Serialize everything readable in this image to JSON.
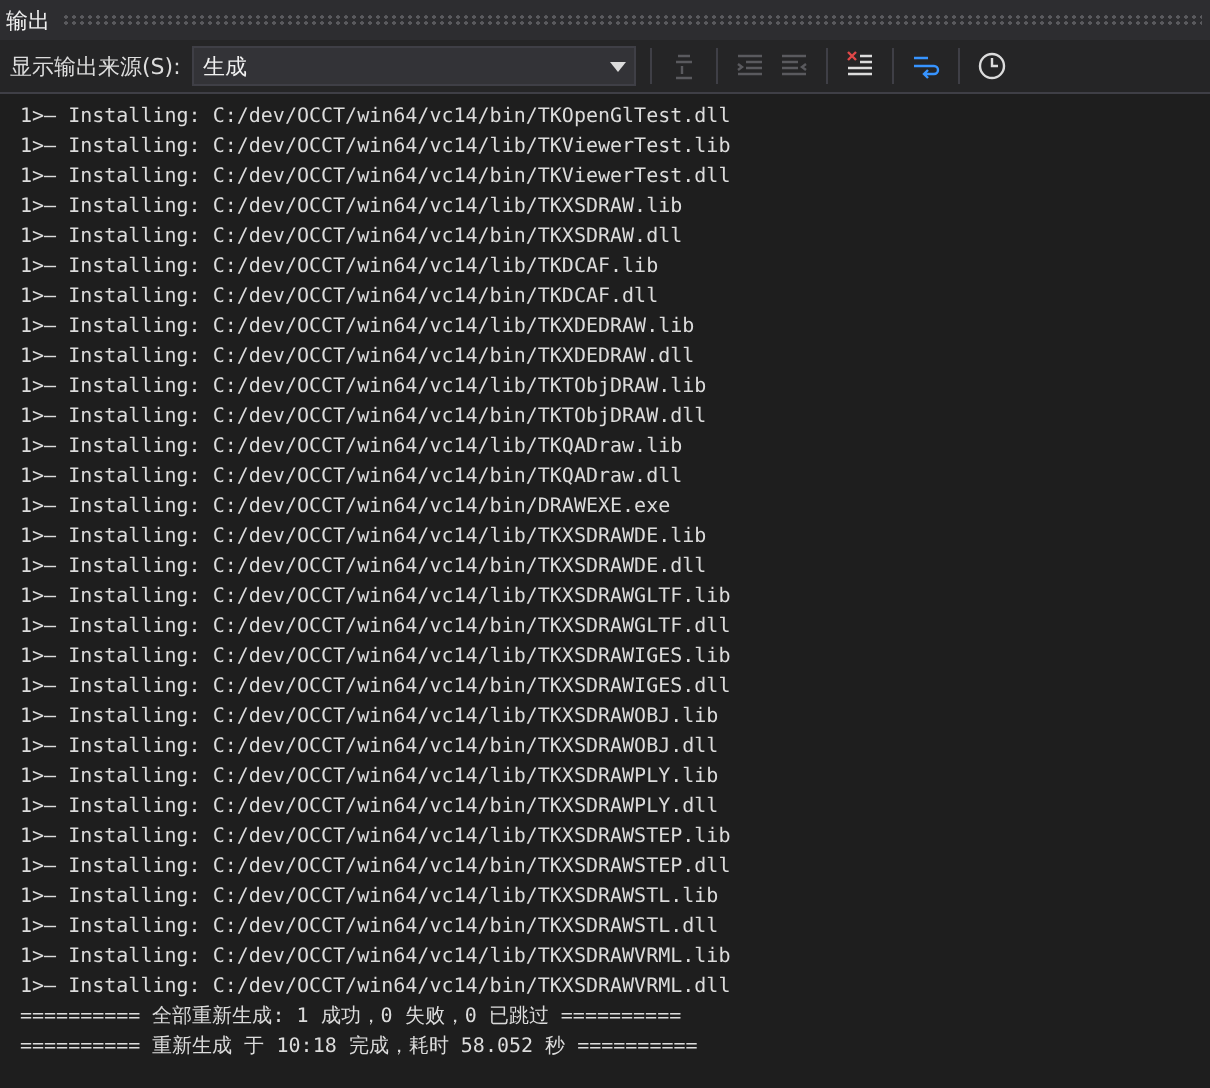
{
  "panel": {
    "title": "输出"
  },
  "toolbar": {
    "source_label": "显示输出来源(S):",
    "source_value": "生成",
    "groups": [
      [
        {
          "kind": "goto",
          "disabled": true
        }
      ],
      [
        {
          "kind": "prev",
          "disabled": true
        },
        {
          "kind": "next",
          "disabled": true
        }
      ],
      [
        {
          "kind": "clear",
          "disabled": false
        }
      ],
      [
        {
          "kind": "wrap",
          "disabled": false
        }
      ],
      [
        {
          "kind": "clock",
          "disabled": false
        }
      ]
    ]
  },
  "output_lines": [
    "1>— Installing: C:/dev/OCCT/win64/vc14/bin/TKOpenGlTest.dll",
    "1>— Installing: C:/dev/OCCT/win64/vc14/lib/TKViewerTest.lib",
    "1>— Installing: C:/dev/OCCT/win64/vc14/bin/TKViewerTest.dll",
    "1>— Installing: C:/dev/OCCT/win64/vc14/lib/TKXSDRAW.lib",
    "1>— Installing: C:/dev/OCCT/win64/vc14/bin/TKXSDRAW.dll",
    "1>— Installing: C:/dev/OCCT/win64/vc14/lib/TKDCAF.lib",
    "1>— Installing: C:/dev/OCCT/win64/vc14/bin/TKDCAF.dll",
    "1>— Installing: C:/dev/OCCT/win64/vc14/lib/TKXDEDRAW.lib",
    "1>— Installing: C:/dev/OCCT/win64/vc14/bin/TKXDEDRAW.dll",
    "1>— Installing: C:/dev/OCCT/win64/vc14/lib/TKTObjDRAW.lib",
    "1>— Installing: C:/dev/OCCT/win64/vc14/bin/TKTObjDRAW.dll",
    "1>— Installing: C:/dev/OCCT/win64/vc14/lib/TKQADraw.lib",
    "1>— Installing: C:/dev/OCCT/win64/vc14/bin/TKQADraw.dll",
    "1>— Installing: C:/dev/OCCT/win64/vc14/bin/DRAWEXE.exe",
    "1>— Installing: C:/dev/OCCT/win64/vc14/lib/TKXSDRAWDE.lib",
    "1>— Installing: C:/dev/OCCT/win64/vc14/bin/TKXSDRAWDE.dll",
    "1>— Installing: C:/dev/OCCT/win64/vc14/lib/TKXSDRAWGLTF.lib",
    "1>— Installing: C:/dev/OCCT/win64/vc14/bin/TKXSDRAWGLTF.dll",
    "1>— Installing: C:/dev/OCCT/win64/vc14/lib/TKXSDRAWIGES.lib",
    "1>— Installing: C:/dev/OCCT/win64/vc14/bin/TKXSDRAWIGES.dll",
    "1>— Installing: C:/dev/OCCT/win64/vc14/lib/TKXSDRAWOBJ.lib",
    "1>— Installing: C:/dev/OCCT/win64/vc14/bin/TKXSDRAWOBJ.dll",
    "1>— Installing: C:/dev/OCCT/win64/vc14/lib/TKXSDRAWPLY.lib",
    "1>— Installing: C:/dev/OCCT/win64/vc14/bin/TKXSDRAWPLY.dll",
    "1>— Installing: C:/dev/OCCT/win64/vc14/lib/TKXSDRAWSTEP.lib",
    "1>— Installing: C:/dev/OCCT/win64/vc14/bin/TKXSDRAWSTEP.dll",
    "1>— Installing: C:/dev/OCCT/win64/vc14/lib/TKXSDRAWSTL.lib",
    "1>— Installing: C:/dev/OCCT/win64/vc14/bin/TKXSDRAWSTL.dll",
    "1>— Installing: C:/dev/OCCT/win64/vc14/lib/TKXSDRAWVRML.lib",
    "1>— Installing: C:/dev/OCCT/win64/vc14/bin/TKXSDRAWVRML.dll",
    "========== 全部重新生成: 1 成功，0 失败，0 已跳过 ==========",
    "========== 重新生成 于 10:18 完成，耗时 58.052 秒 =========="
  ]
}
